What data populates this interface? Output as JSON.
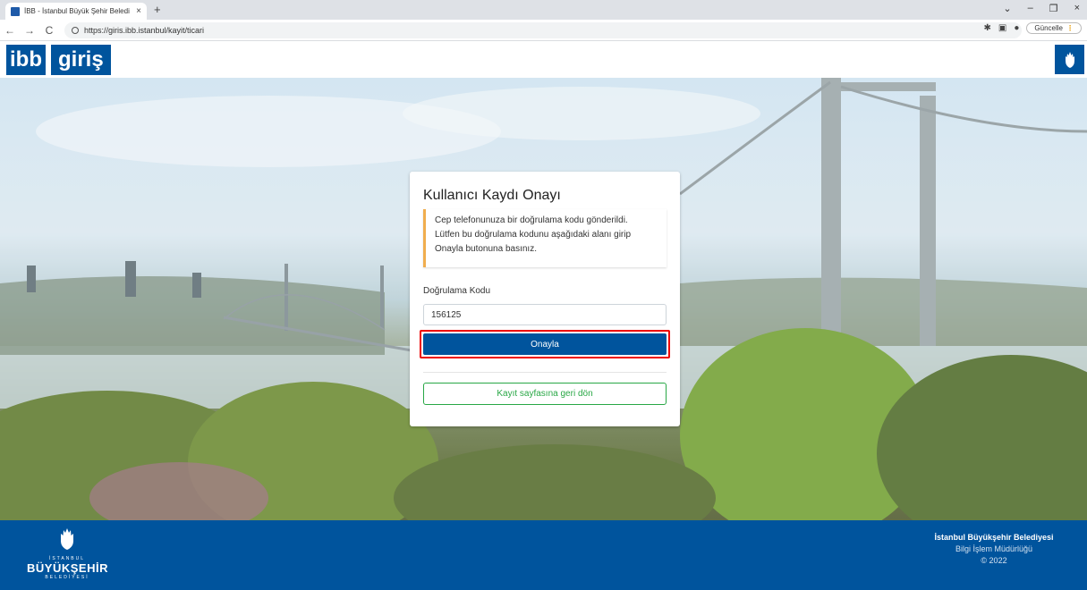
{
  "browser": {
    "tab_title": "İBB - İstanbul Büyük Şehir Beledi",
    "tab_close": "×",
    "new_tab": "+",
    "window_controls": [
      "⌄",
      "–",
      "❐",
      "×"
    ],
    "nav": {
      "back": "←",
      "forward": "→",
      "reload": "C"
    },
    "url": "https://giris.ibb.istanbul/kayit/ticari",
    "update_label": "Güncelle"
  },
  "header": {
    "logo_part1": "ibb",
    "logo_part2": "giriş"
  },
  "card": {
    "title": "Kullanıcı Kaydı Onayı",
    "alert_line1": "Cep telefonunuza bir doğrulama kodu gönderildi.",
    "alert_line2": "Lütfen bu doğrulama kodunu aşağıdaki alanı girip",
    "alert_line3": "Onayla butonuna basınız.",
    "code_label": "Doğrulama Kodu",
    "code_value": "156125",
    "approve_label": "Onayla",
    "back_label": "Kayıt sayfasına geri dön"
  },
  "footer": {
    "logo_top": "İSTANBUL",
    "logo_main": "BÜYÜKŞEHİR",
    "logo_bottom": "BELEDİYESİ",
    "org": "İstanbul Büyükşehir Belediyesi",
    "dept": "Bilgi İşlem Müdürlüğü",
    "copyright": "© 2022"
  },
  "colors": {
    "brand_blue": "#00549d",
    "highlight_red": "#e00000",
    "success_green": "#28a745",
    "warning_orange": "#f0ad4e"
  }
}
